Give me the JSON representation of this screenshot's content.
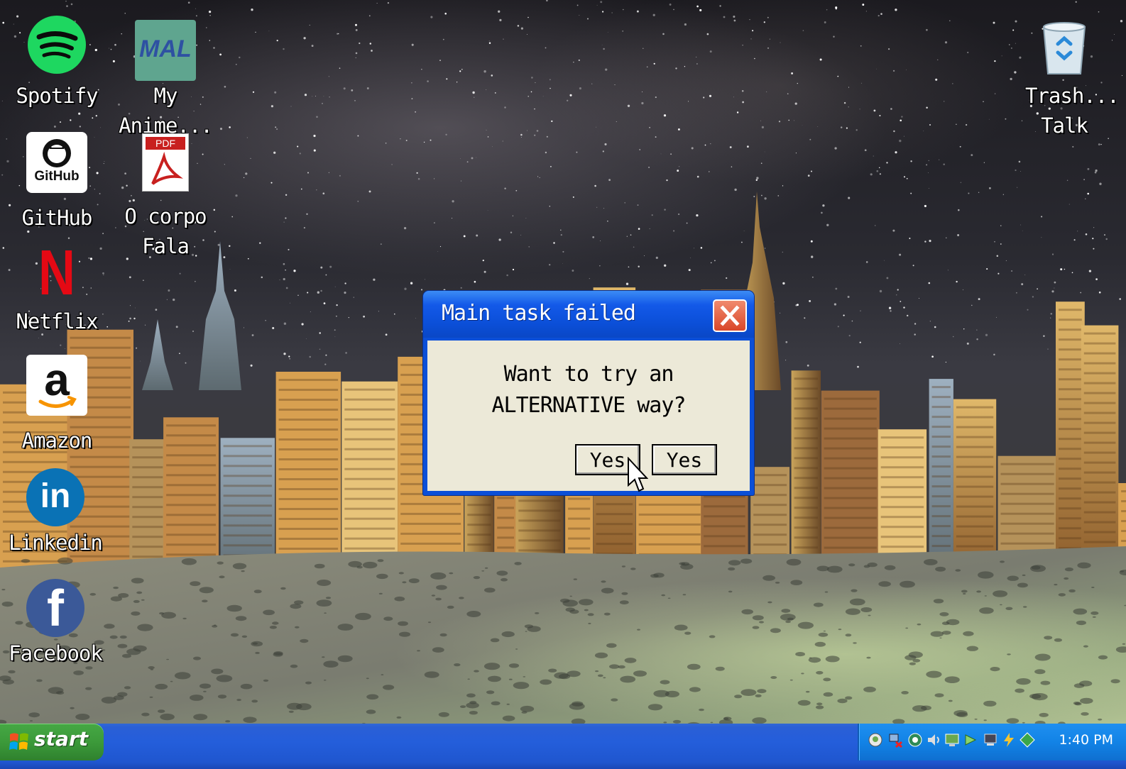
{
  "desktop": {
    "icons": [
      {
        "label": "Spotify",
        "icon": "spotify-icon"
      },
      {
        "label": "My Anime...",
        "icon": "mal-icon",
        "glyph_text": "MAL"
      },
      {
        "label": "GitHub",
        "icon": "github-icon",
        "glyph_text": "GitHub"
      },
      {
        "label": "O corpo Fala",
        "icon": "pdf-icon",
        "glyph_text": "PDF"
      },
      {
        "label": "Netflix",
        "icon": "netflix-icon",
        "glyph_text": "N"
      },
      {
        "label": "Amazon",
        "icon": "amazon-icon",
        "glyph_text": "a"
      },
      {
        "label": "Linkedin",
        "icon": "linkedin-icon",
        "glyph_text": "in"
      },
      {
        "label": "Facebook",
        "icon": "facebook-icon",
        "glyph_text": "f"
      },
      {
        "label": "Trash... Talk",
        "icon": "recycle-bin-icon"
      }
    ]
  },
  "dialog": {
    "title": "Main task failed",
    "message": "Want to try an ALTERNATIVE way?",
    "buttons": [
      "Yes",
      "Yes"
    ]
  },
  "taskbar": {
    "start_label": "start",
    "clock": "1:40 PM"
  },
  "colors": {
    "taskbar_blue": "#245edb",
    "start_green": "#3c9a3a",
    "dialog_blue": "#0b4fd8",
    "dialog_body": "#ece9d8",
    "close_red": "#d9472a"
  }
}
